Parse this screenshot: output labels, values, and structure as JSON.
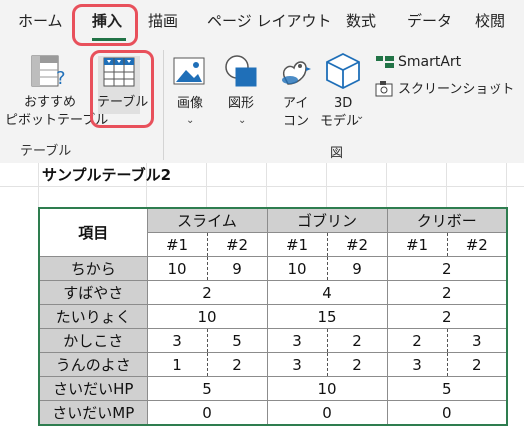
{
  "ribbon": {
    "tabs": [
      "ホーム",
      "挿入",
      "描画",
      "ページ レイアウト",
      "数式",
      "データ",
      "校閲"
    ],
    "active_tab": "挿入",
    "groups": {
      "table": {
        "label": "テーブル",
        "recommended_pivot": [
          "おすすめ",
          "ピボットテーブル"
        ],
        "table_button": "テーブル"
      },
      "illustrations": {
        "label": "図",
        "image": "画像",
        "shapes": "図形",
        "icons": [
          "アイ",
          "コン"
        ],
        "models3d": [
          "3D",
          "モデル"
        ],
        "smartart": "SmartArt",
        "screenshot": "スクリーンショット"
      }
    },
    "accent_color": "#217346",
    "highlight_color": "#e8505b"
  },
  "sheet": {
    "caption": "サンプルテーブル2",
    "table": {
      "header_item": "項目",
      "groups": [
        "スライム",
        "ゴブリン",
        "クリボー"
      ],
      "sub": [
        "#1",
        "#2"
      ],
      "rows": [
        {
          "label": "ちから",
          "cells": [
            {
              "v": "10"
            },
            {
              "v": "9"
            },
            {
              "v": "10"
            },
            {
              "v": "9"
            },
            {
              "v": "2",
              "span": 2
            }
          ]
        },
        {
          "label": "すばやさ",
          "cells": [
            {
              "v": "2",
              "span": 2
            },
            {
              "v": "4",
              "span": 2
            },
            {
              "v": "2",
              "span": 2
            }
          ]
        },
        {
          "label": "たいりょく",
          "cells": [
            {
              "v": "10",
              "span": 2
            },
            {
              "v": "15",
              "span": 2
            },
            {
              "v": "2",
              "span": 2
            }
          ]
        },
        {
          "label": "かしこさ",
          "cells": [
            {
              "v": "3"
            },
            {
              "v": "5"
            },
            {
              "v": "3"
            },
            {
              "v": "2"
            },
            {
              "v": "2"
            },
            {
              "v": "3"
            }
          ]
        },
        {
          "label": "うんのよさ",
          "cells": [
            {
              "v": "1"
            },
            {
              "v": "2"
            },
            {
              "v": "3"
            },
            {
              "v": "2"
            },
            {
              "v": "3"
            },
            {
              "v": "2"
            }
          ]
        },
        {
          "label": "さいだいHP",
          "cells": [
            {
              "v": "5",
              "span": 2
            },
            {
              "v": "10",
              "span": 2
            },
            {
              "v": "5",
              "span": 2
            }
          ]
        },
        {
          "label": "さいだいMP",
          "cells": [
            {
              "v": "0",
              "span": 2
            },
            {
              "v": "0",
              "span": 2
            },
            {
              "v": "0",
              "span": 2
            }
          ]
        }
      ]
    }
  }
}
